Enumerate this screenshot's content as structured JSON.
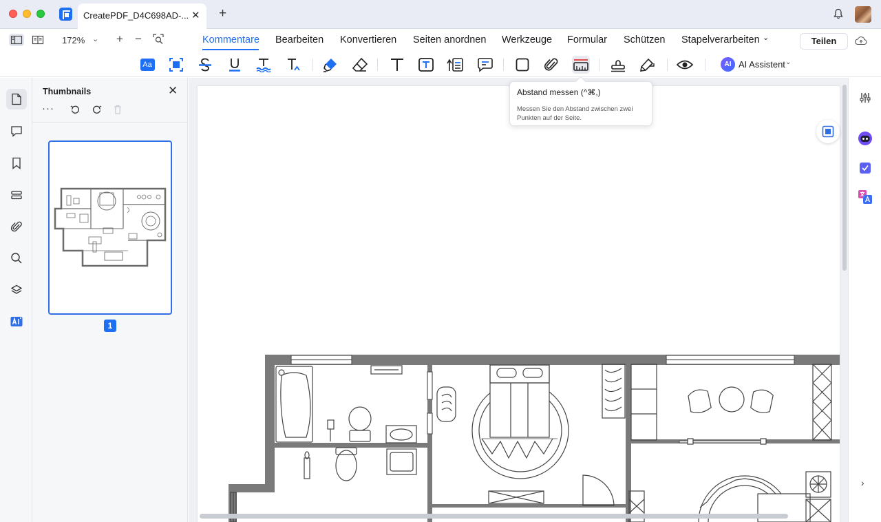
{
  "window": {
    "tab_title": "CreatePDF_D4C698AD-...",
    "tab_close": "✕",
    "new_tab": "+"
  },
  "menubar": {
    "zoom": "172%",
    "zoom_caret": "⌄",
    "zoom_in": "+",
    "zoom_out": "−",
    "items": [
      "Kommentare",
      "Bearbeiten",
      "Konvertieren",
      "Seiten anordnen",
      "Werkzeuge",
      "Formular",
      "Schützen",
      "Stapelverarbeiten"
    ],
    "active_item": "Kommentare",
    "more_caret": "⌄",
    "share": "Teilen"
  },
  "toolbar": {
    "tools": [
      "text-style",
      "area-highlight",
      "strikethrough",
      "underline",
      "squiggly",
      "insert-text",
      "highlighter",
      "eraser",
      "text-box",
      "text-callout",
      "callout",
      "note",
      "rectangle",
      "attachment",
      "measure-distance",
      "stamp",
      "signature",
      "show-hide"
    ],
    "selected_tool": "measure-distance",
    "text_style_label": "Aa",
    "ai_badge": "AI",
    "ai_label": "AI Assistent",
    "ai_caret": "⌄"
  },
  "tooltip": {
    "title": "Abstand messen (^⌘,)",
    "description": "Messen Sie den Abstand zwischen zwei Punkten auf der Seite."
  },
  "thumbnails": {
    "title": "Thumbnails",
    "close": "✕",
    "more": "···",
    "page_number": "1"
  },
  "colors": {
    "accent": "#1f6ff2",
    "tab_bar": "#e9ecf5",
    "panel_bg": "#f6f7f9",
    "wall": "#7a7a7a"
  }
}
